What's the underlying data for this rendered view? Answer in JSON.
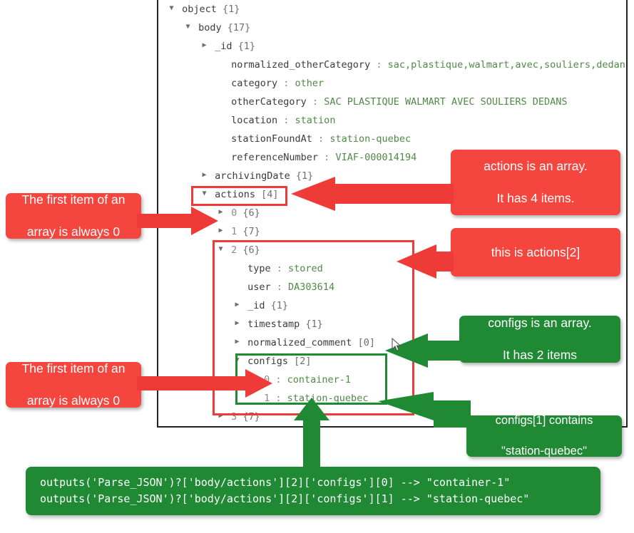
{
  "tree": {
    "rows": [
      {
        "indent": 0,
        "caret": "down",
        "key": "object",
        "count": "{1}"
      },
      {
        "indent": 1,
        "caret": "down",
        "key": "body",
        "count": "{17}"
      },
      {
        "indent": 2,
        "caret": "right",
        "key": "_id",
        "count": "{1}"
      },
      {
        "indent": 3,
        "caret": "none",
        "key": "normalized_otherCategory",
        "colon": ":",
        "value": "sac,plastique,walmart,avec,souliers,dedans"
      },
      {
        "indent": 3,
        "caret": "none",
        "key": "category",
        "colon": ":",
        "value": "other"
      },
      {
        "indent": 3,
        "caret": "none",
        "key": "otherCategory",
        "colon": ":",
        "value": "SAC PLASTIQUE WALMART AVEC SOULIERS DEDANS"
      },
      {
        "indent": 3,
        "caret": "none",
        "key": "location",
        "colon": ":",
        "value": "station"
      },
      {
        "indent": 3,
        "caret": "none",
        "key": "stationFoundAt",
        "colon": ":",
        "value": "station-quebec"
      },
      {
        "indent": 3,
        "caret": "none",
        "key": "referenceNumber",
        "colon": ":",
        "value": "VIAF-000014194"
      },
      {
        "indent": 2,
        "caret": "right",
        "key": "archivingDate",
        "count": "{1}"
      },
      {
        "indent": 2,
        "caret": "down",
        "key": "actions",
        "count": "[4]"
      },
      {
        "indent": 3,
        "caret": "right",
        "key": "0",
        "count": "{6}",
        "isIndex": true
      },
      {
        "indent": 3,
        "caret": "right",
        "key": "1",
        "count": "{7}",
        "isIndex": true
      },
      {
        "indent": 3,
        "caret": "down",
        "key": "2",
        "count": "{6}",
        "isIndex": true
      },
      {
        "indent": 4,
        "caret": "none",
        "key": "type",
        "colon": ":",
        "value": "stored"
      },
      {
        "indent": 4,
        "caret": "none",
        "key": "user",
        "colon": ":",
        "value": "DA303614"
      },
      {
        "indent": 4,
        "caret": "right",
        "key": "_id",
        "count": "{1}"
      },
      {
        "indent": 4,
        "caret": "right",
        "key": "timestamp",
        "count": "{1}"
      },
      {
        "indent": 4,
        "caret": "right",
        "key": "normalized_comment",
        "count": "[0]"
      },
      {
        "indent": 4,
        "caret": "down",
        "key": "configs",
        "count": "[2]"
      },
      {
        "indent": 5,
        "caret": "none",
        "key": "0",
        "colon": ":",
        "value": "container-1",
        "isIndex": true
      },
      {
        "indent": 5,
        "caret": "none",
        "key": "1",
        "colon": ":",
        "value": "station-quebec",
        "isIndex": true
      },
      {
        "indent": 3,
        "caret": "right",
        "key": "3",
        "count": "{7}",
        "isIndex": true
      }
    ]
  },
  "callouts": {
    "actions_array": {
      "line1": "actions is an array.",
      "line2": "It has 4 items."
    },
    "first_item_top": {
      "line1": "The first item of an",
      "line2": "array is always 0"
    },
    "this_is_actions2": {
      "line1": "this is actions[2]"
    },
    "configs_array": {
      "line1": "configs is an array.",
      "line2": "It has 2 items"
    },
    "first_item_bottom": {
      "line1": "The first item of an",
      "line2": "array is always 0"
    },
    "configs1_contains": {
      "line1": "configs[1] contains",
      "line2": "\"station-quebec\""
    }
  },
  "code": {
    "line1": "outputs('Parse_JSON')?['body/actions'][2]['configs'][0] --> \"container-1\"",
    "line2": "outputs('Parse_JSON')?['body/actions'][2]['configs'][1] --> \"station-quebec\""
  },
  "colors": {
    "red": "#f4453f",
    "red_border": "#ef3b38",
    "green": "#1f8a33",
    "green_border": "#1e8a32",
    "value_text": "#4f8a46",
    "key_text": "#3b3b3b",
    "panel_border": "#222222"
  }
}
